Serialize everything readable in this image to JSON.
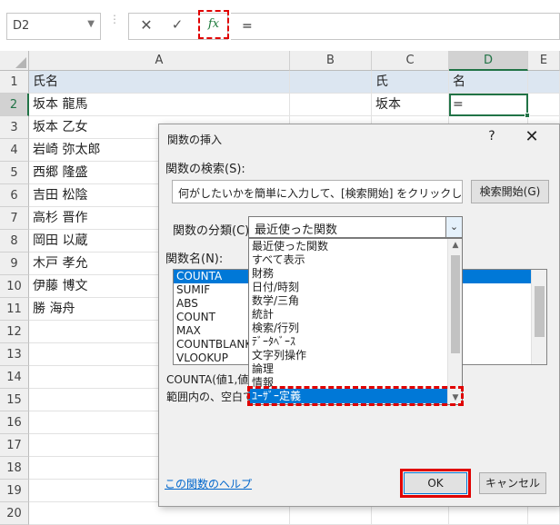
{
  "formula_bar": {
    "name_box": "D2",
    "cancel_symbol": "✕",
    "enter_symbol": "✓",
    "fx_label": "fx",
    "formula": "="
  },
  "columns": [
    "A",
    "B",
    "C",
    "D",
    "E"
  ],
  "rows": [
    {
      "num": "1",
      "A": "氏名",
      "C": "氏",
      "D": "名"
    },
    {
      "num": "2",
      "A": "坂本 龍馬",
      "C": "坂本",
      "D": "="
    },
    {
      "num": "3",
      "A": "坂本 乙女"
    },
    {
      "num": "4",
      "A": "岩崎 弥太郎"
    },
    {
      "num": "5",
      "A": "西郷 隆盛"
    },
    {
      "num": "6",
      "A": "吉田 松陰"
    },
    {
      "num": "7",
      "A": "高杉 晋作"
    },
    {
      "num": "8",
      "A": "岡田 以蔵"
    },
    {
      "num": "9",
      "A": "木戸 孝允"
    },
    {
      "num": "10",
      "A": "伊藤 博文"
    },
    {
      "num": "11",
      "A": "勝 海舟"
    },
    {
      "num": "12"
    },
    {
      "num": "13"
    },
    {
      "num": "14"
    },
    {
      "num": "15"
    },
    {
      "num": "16"
    },
    {
      "num": "17"
    },
    {
      "num": "18"
    },
    {
      "num": "19"
    },
    {
      "num": "20"
    }
  ],
  "dialog": {
    "title": "関数の挿入",
    "help": "?",
    "close": "✕",
    "search_label": "関数の検索(S):",
    "search_text": "何がしたいかを簡単に入力して、[検索開始] をクリックしてください。",
    "search_button": "検索開始(G)",
    "category_label": "関数の分類(C):",
    "category_value": "最近使った関数",
    "function_label": "関数名(N):",
    "functions": [
      "COUNTA",
      "SUMIF",
      "ABS",
      "COUNT",
      "MAX",
      "COUNTBLANK",
      "VLOOKUP"
    ],
    "description_syntax": "COUNTA(値1,値",
    "description_text": "範囲内の、空白で",
    "help_link": "この関数のヘルプ",
    "ok": "OK",
    "cancel": "キャンセル"
  },
  "category_dropdown": {
    "items": [
      "最近使った関数",
      "すべて表示",
      "財務",
      "日付/時刻",
      "数学/三角",
      "統計",
      "検索/行列",
      "ﾃﾞｰﾀﾍﾞｰｽ",
      "文字列操作",
      "論理",
      "情報",
      "ﾕｰｻﾞｰ定義"
    ],
    "highlighted": "ﾕｰｻﾞｰ定義"
  },
  "colors": {
    "selection_blue": "#0078d7",
    "excel_green": "#217346",
    "annotation_red": "#e00000"
  }
}
